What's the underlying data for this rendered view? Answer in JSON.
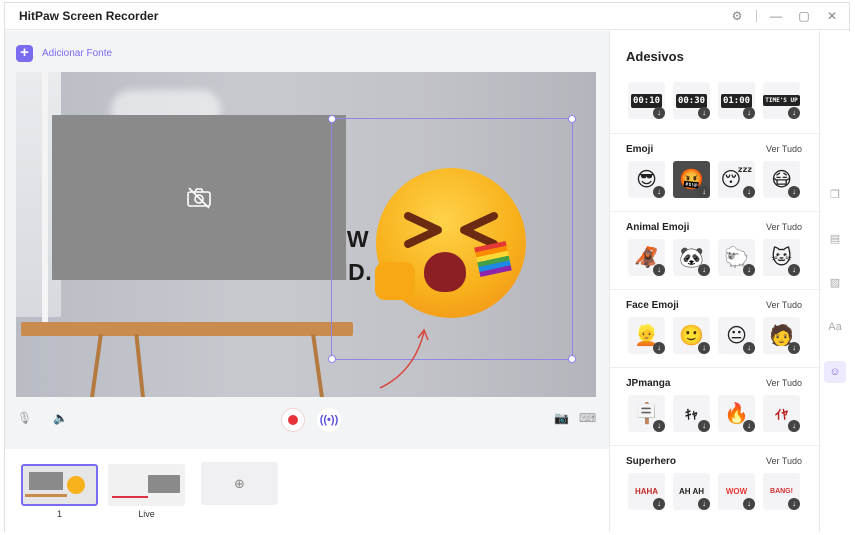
{
  "app": {
    "title": "HitPaw Screen Recorder",
    "window_controls": [
      "gear-icon",
      "minimize-icon",
      "maximize-icon",
      "close-icon"
    ]
  },
  "source": {
    "add_label": "Adicionar Fonte"
  },
  "canvas": {
    "background_text_line1": "EW IT,",
    "background_text_line2": "ND."
  },
  "scenes": {
    "items": [
      {
        "label": "1",
        "active": true
      },
      {
        "label": "Live",
        "active": false
      }
    ]
  },
  "panel": {
    "title": "Adesivos",
    "timer_stickers": [
      "00:10",
      "00:30",
      "01:00",
      "TIME'S UP"
    ],
    "sections": [
      {
        "title": "Emoji",
        "action": "Ver Tudo",
        "stickers": [
          "😎",
          "🤬",
          "😴",
          "😷"
        ]
      },
      {
        "title": "Animal Emoji",
        "action": "Ver Tudo",
        "stickers": [
          "🦧",
          "🐼",
          "🐑",
          "🐱"
        ]
      },
      {
        "title": "Face Emoji",
        "action": "Ver Tudo",
        "stickers": [
          "👱",
          "🙂",
          "😐",
          "🧑"
        ]
      },
      {
        "title": "JPmanga",
        "action": "Ver Tudo",
        "stickers": [
          "🪧",
          "ｷｬ",
          "🔥",
          "ｲﾔ"
        ]
      },
      {
        "title": "Superhero",
        "action": "Ver Tudo",
        "stickers": [
          "HAHA",
          "AH AH",
          "WOW",
          "BANG!"
        ]
      }
    ]
  },
  "rail": [
    "layers-icon",
    "layout-icon",
    "pattern-icon",
    "text-icon",
    "sticker-icon"
  ],
  "colors": {
    "accent": "#7a6cf0",
    "record": "#e8343b"
  }
}
